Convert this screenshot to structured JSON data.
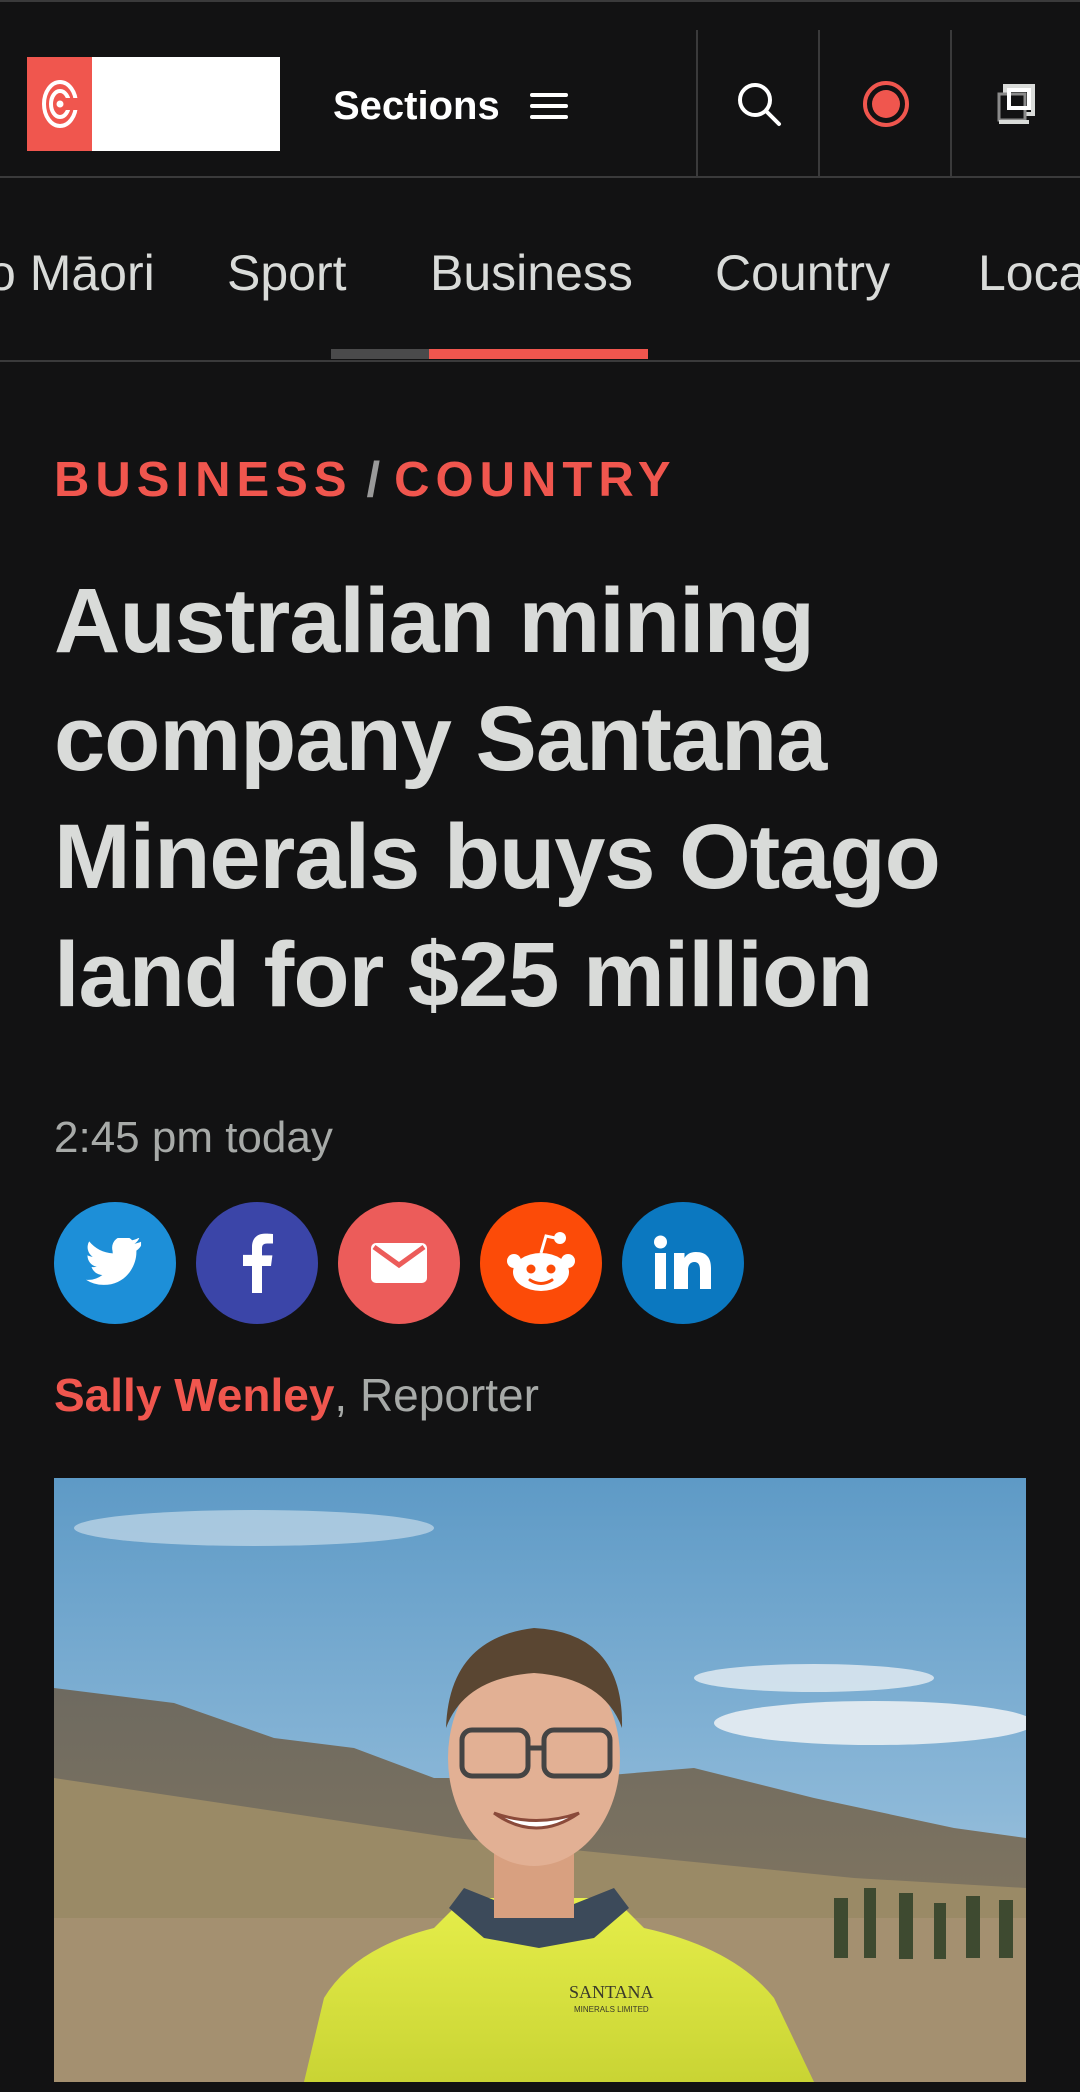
{
  "header": {
    "sections_label": "Sections"
  },
  "nav": {
    "tabs": [
      {
        "label": "o Māori"
      },
      {
        "label": "Sport"
      },
      {
        "label": "Business",
        "active": true
      },
      {
        "label": "Country"
      },
      {
        "label": "Loca"
      }
    ]
  },
  "article": {
    "breadcrumb": [
      "BUSINESS",
      "COUNTRY"
    ],
    "breadcrumb_separator": "/",
    "headline": "Australian mining company Santana Minerals buys Otago land for $25 million",
    "timestamp": "2:45 pm today",
    "author": "Sally Wenley",
    "author_suffix": ", Reporter",
    "photo_shirt_text": "SANTANA",
    "photo_shirt_subtext": "MINERALS LIMITED"
  },
  "share": [
    {
      "name": "twitter",
      "color": "#1d8fd8"
    },
    {
      "name": "facebook",
      "color": "#3b45a8"
    },
    {
      "name": "email",
      "color": "#ec5c5a"
    },
    {
      "name": "reddit",
      "color": "#fc4b08"
    },
    {
      "name": "linkedin",
      "color": "#0b78c0"
    }
  ],
  "colors": {
    "accent": "#f0564e",
    "background": "#121213",
    "text": "#d9dbd9"
  }
}
